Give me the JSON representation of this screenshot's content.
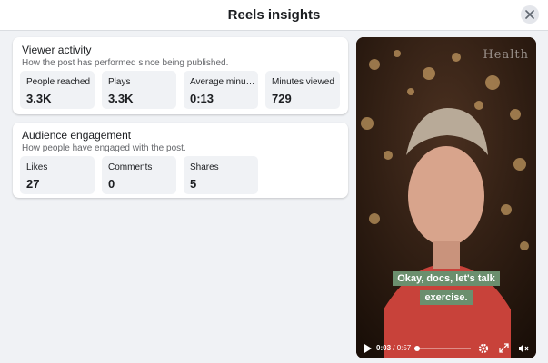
{
  "header": {
    "title": "Reels insights",
    "close_icon": "close-icon"
  },
  "viewer_activity": {
    "title": "Viewer activity",
    "subtitle": "How the post has performed since being published.",
    "metrics": [
      {
        "label": "People reached",
        "value": "3.3K"
      },
      {
        "label": "Plays",
        "value": "3.3K"
      },
      {
        "label": "Average minutes viewed",
        "value": "0:13"
      },
      {
        "label": "Minutes viewed",
        "value": "729"
      }
    ]
  },
  "audience_engagement": {
    "title": "Audience engagement",
    "subtitle": "How people have engaged with the post.",
    "metrics": [
      {
        "label": "Likes",
        "value": "27"
      },
      {
        "label": "Comments",
        "value": "0"
      },
      {
        "label": "Shares",
        "value": "5"
      }
    ]
  },
  "video": {
    "watermark": "Health",
    "caption_line1": "Okay, docs, let's talk",
    "caption_line2": "exercise.",
    "current_time": "0:03",
    "separator": " / ",
    "duration": "0:57",
    "progress": 0.053,
    "caption_color": "#6b8f6e"
  }
}
